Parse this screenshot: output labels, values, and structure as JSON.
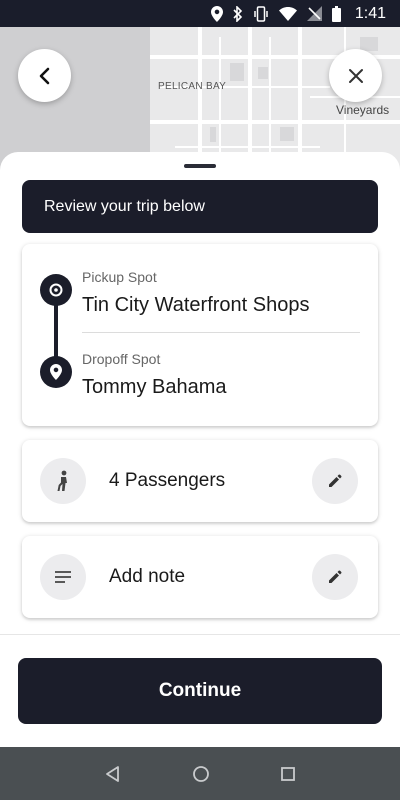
{
  "status_bar": {
    "time": "1:41",
    "icons": [
      "location-icon",
      "bluetooth-icon",
      "vibrate-icon",
      "wifi-icon",
      "no-signal-icon",
      "battery-icon"
    ]
  },
  "map": {
    "labels": {
      "pelican_bay": "PELICAN BAY",
      "vineyards": "Vineyards"
    }
  },
  "header": {
    "back_icon": "back-arrow-icon",
    "close_icon": "close-icon"
  },
  "banner": {
    "text": "Review your trip below"
  },
  "trip": {
    "pickup_label": "Pickup Spot",
    "pickup_value": "Tin City Waterfront Shops",
    "dropoff_label": "Dropoff Spot",
    "dropoff_value": "Tommy Bahama"
  },
  "passengers": {
    "text": "4 Passengers",
    "icon": "person-icon"
  },
  "note": {
    "text": "Add note",
    "icon": "notes-icon"
  },
  "continue_label": "Continue",
  "colors": {
    "dark": "#1b1d2a",
    "nav_bar": "#4a4f52",
    "icon_bg": "#ececee"
  }
}
